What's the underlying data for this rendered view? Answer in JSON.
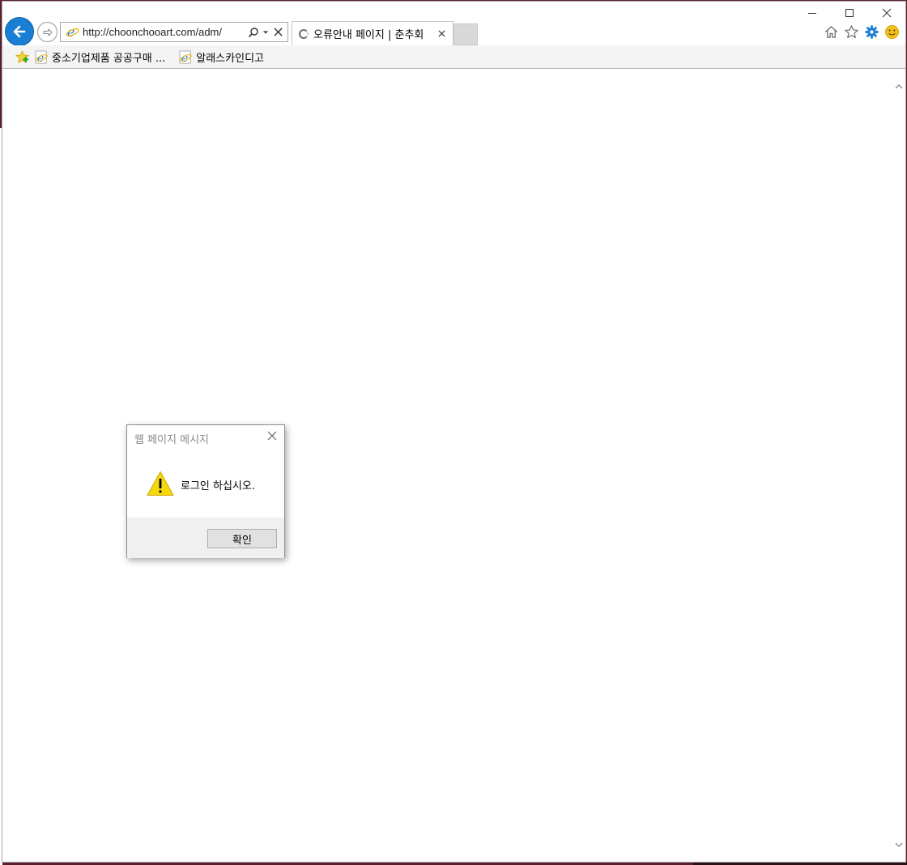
{
  "browser": {
    "address_url": "http://choonchooart.com/adm/",
    "tab_title": "오류안내 페이지 | 춘추회"
  },
  "favorites": {
    "items": [
      {
        "label": "중소기업제품 공공구매 ..."
      },
      {
        "label": "알래스카인디고"
      }
    ]
  },
  "dialog": {
    "title": "웹 페이지 메시지",
    "message": "로그인 하십시오.",
    "ok_label": "확인"
  },
  "colors": {
    "back_button": "#1a7fd4",
    "gear": "#1a7fd4",
    "warning": "#f5d90a",
    "smiley": "#f2c11b"
  },
  "icons": [
    "back-arrow-icon",
    "forward-arrow-icon",
    "ie-icon",
    "search-icon",
    "dropdown-icon",
    "stop-icon",
    "loading-icon",
    "close-icon",
    "minimize-icon",
    "maximize-icon",
    "home-icon",
    "star-icon",
    "gear-icon",
    "smiley-icon",
    "add-favorites-icon",
    "warning-icon",
    "scroll-up-icon",
    "scroll-down-icon"
  ]
}
